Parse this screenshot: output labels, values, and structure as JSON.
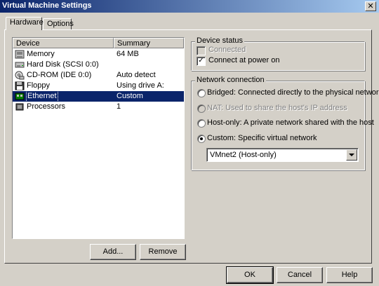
{
  "window": {
    "title": "Virtual Machine Settings",
    "close_glyph": "✕"
  },
  "tabs": [
    {
      "label": "Hardware",
      "active": true
    },
    {
      "label": "Options",
      "active": false
    }
  ],
  "device_list": {
    "columns": [
      "Device",
      "Summary"
    ],
    "rows": [
      {
        "icon": "memory-icon",
        "device": "Memory",
        "summary": "64 MB",
        "selected": false
      },
      {
        "icon": "hard-disk-icon",
        "device": "Hard Disk (SCSI 0:0)",
        "summary": "",
        "selected": false
      },
      {
        "icon": "cdrom-icon",
        "device": "CD-ROM (IDE 0:0)",
        "summary": "Auto detect",
        "selected": false
      },
      {
        "icon": "floppy-icon",
        "device": "Floppy",
        "summary": "Using drive A:",
        "selected": false
      },
      {
        "icon": "ethernet-icon",
        "device": "Ethernet",
        "summary": "Custom",
        "selected": true
      },
      {
        "icon": "processor-icon",
        "device": "Processors",
        "summary": "1",
        "selected": false
      }
    ]
  },
  "list_buttons": {
    "add": "Add...",
    "remove": "Remove"
  },
  "device_status": {
    "title": "Device status",
    "connected": {
      "label": "Connected",
      "checked": false,
      "disabled": true
    },
    "connect_at_power_on": {
      "label": "Connect at power on",
      "checked": true
    }
  },
  "network_connection": {
    "title": "Network connection",
    "options": [
      {
        "label": "Bridged: Connected directly to the physical network",
        "selected": false,
        "disabled": false
      },
      {
        "label": "NAT: Used to share the host's IP address",
        "selected": false,
        "disabled": true
      },
      {
        "label": "Host-only: A private network shared with the host",
        "selected": false,
        "disabled": false
      },
      {
        "label": "Custom: Specific virtual network",
        "selected": true,
        "disabled": false
      }
    ],
    "custom_network": {
      "value": "VMnet2 (Host-only)"
    }
  },
  "dialog_buttons": {
    "ok": "OK",
    "cancel": "Cancel",
    "help": "Help"
  },
  "colors": {
    "face": "#d4d0c8",
    "selection": "#0a246a",
    "title_start": "#0a246a",
    "title_end": "#a6caf0"
  }
}
